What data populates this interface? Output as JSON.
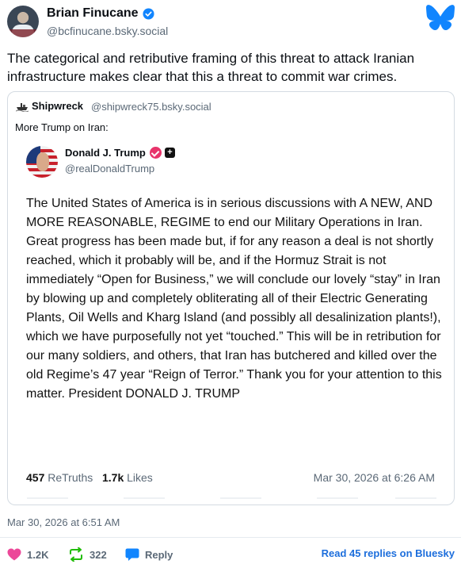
{
  "author": {
    "name": "Brian Finucane",
    "handle": "@bcfinucane.bsky.social",
    "verified": true
  },
  "post_text": "The categorical and retributive framing of this threat to attack Iranian infrastructure makes clear that this a threat to commit war crimes.",
  "quote": {
    "author_name": "Shipwreck",
    "author_handle": "@shipwreck75.bsky.social",
    "text": "More Trump on Iran:",
    "embedded": {
      "name": "Donald J. Trump",
      "handle": "@realDonaldTrump",
      "body": "The United States of America is in serious discussions with A NEW, AND MORE REASONABLE, REGIME to end our Military Operations in Iran. Great progress has been made but, if for any reason a deal is not shortly reached, which it probably will be, and if the Hormuz Strait is not immediately “Open for Business,” we will conclude our lovely “stay” in Iran by blowing up and completely obliterating all of their Electric Generating Plants, Oil Wells and Kharg Island (and possibly all desalinization plants!), which we have purposefully not yet “touched.” This will be in retribution for our many soldiers, and others, that Iran has butchered and killed over the old Regime’s 47 year “Reign of Terror.” Thank you for your attention to this matter. President DONALD J. TRUMP",
      "retruths_count": "457",
      "retruths_label": "ReTruths",
      "likes_count": "1.7k",
      "likes_label": "Likes",
      "date": "Mar 30, 2026 at 6:26 AM"
    }
  },
  "post_date": "Mar 30, 2026 at 6:51 AM",
  "actions": {
    "likes": "1.2K",
    "reposts": "322",
    "reply_label": "Reply",
    "read_replies": "Read 45 replies on Bluesky"
  },
  "colors": {
    "bluesky_blue": "#1185fe",
    "verified_blue": "#1185fe",
    "like_pink": "#ec4899",
    "repost_green": "#20bc07",
    "link_blue": "#1c6edc"
  },
  "icons": [
    "verified-icon",
    "bluesky-butterfly-icon",
    "heart-icon",
    "repost-icon",
    "reply-icon"
  ]
}
